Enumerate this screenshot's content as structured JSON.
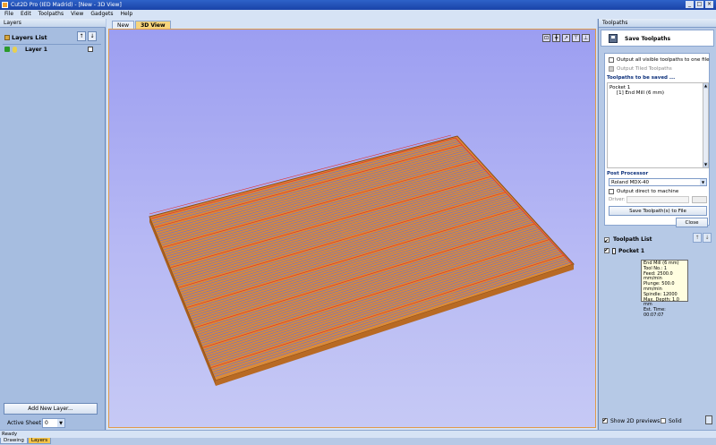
{
  "window": {
    "title": "Cut2D Pro (IED Madrid) - [New - 3D View]",
    "buttons": [
      "_",
      "□",
      "×"
    ]
  },
  "menu": [
    "File",
    "Edit",
    "Toolpaths",
    "View",
    "Gadgets",
    "Help"
  ],
  "left_panel": {
    "title": "Layers",
    "layers_list_title": "Layers List",
    "up_arrow": "↑",
    "down_arrow": "↓",
    "layers": [
      {
        "name": "Layer 1"
      }
    ],
    "add_layer_button": "Add New Layer...",
    "active_sheet_label": "Active Sheet",
    "active_sheet_value": "0",
    "tabs": [
      "Drawing",
      "Layers"
    ],
    "active_tab": "Layers"
  },
  "center": {
    "tabs": [
      "New",
      "3D View"
    ],
    "active_tab": "3D View",
    "view_tools": [
      "⊡",
      "╋",
      "↗",
      "⊤",
      "⊥"
    ],
    "colors": {
      "background_top": "#9c9ef1",
      "background_bottom": "#c6c9f5",
      "board": "#d98a3a",
      "toolpath_lines": "#7070c8",
      "toolpath_red": "#e03030"
    }
  },
  "toolpaths_panel": {
    "title": "Toolpaths",
    "save_header": "Save Toolpaths",
    "output_all_label": "Output all visible toolpaths to one file",
    "output_tiled_label": "Output Tiled Toolpaths",
    "to_be_saved_title": "Toolpaths to be saved ...",
    "saved_items": [
      "Pocket 1",
      "[1] End Mill (6 mm)"
    ],
    "post_processor_title": "Post Processor",
    "post_processor_value": "Roland MDX-40",
    "output_direct_label": "Output direct to machine",
    "driver_label": "Driver:",
    "save_button": "Save Toolpath(s) to File",
    "close_button": "Close",
    "toolpath_list_title": "Toolpath List",
    "toolpath_items": [
      "Pocket 1"
    ],
    "tooltip_lines": [
      "End Mill (6 mm)",
      "Tool No.: 1",
      "Feed: 2500.0 mm/min",
      "Plunge: 500.0 mm/min",
      "Spindle: 12000",
      "Max. Depth: 1.0 mm",
      "Est. Time: 00:07:07"
    ],
    "show_2d_previews_label": "Show 2D previews",
    "solid_label": "Solid"
  },
  "status": {
    "text": "Ready"
  }
}
